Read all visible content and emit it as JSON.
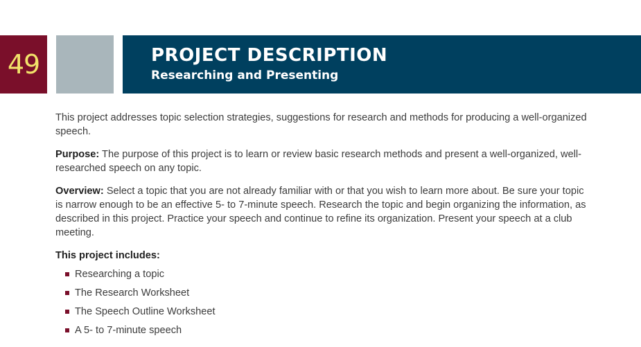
{
  "header": {
    "page_number": "49",
    "title": "PROJECT DESCRIPTION",
    "subtitle": "Researching and Presenting"
  },
  "body": {
    "intro": "This project addresses topic selection strategies, suggestions for research and methods for producing a well-organized speech.",
    "purpose_label": "Purpose:",
    "purpose_text": " The purpose of this project is to learn or review basic research methods and present a well-organized, well-researched speech on any topic.",
    "overview_label": "Overview:",
    "overview_text": " Select a topic that you are not already familiar with or that you wish to learn more about. Be sure your topic is narrow enough to be an effective 5- to 7-minute speech. Research the topic and begin organizing the information, as described in this project. Practice your speech and continue to refine its organization. Present your speech at a club meeting.",
    "includes_heading": "This project includes:",
    "includes": [
      "Researching a topic",
      "The Research Worksheet",
      "The Speech Outline Worksheet",
      "A 5- to 7-minute speech"
    ]
  },
  "colors": {
    "page_number_bg": "#7a0f2a",
    "page_number_text": "#f2e36a",
    "gray_block": "#a9b6bb",
    "title_bar": "#00405f",
    "bullet": "#7a0f2a"
  }
}
